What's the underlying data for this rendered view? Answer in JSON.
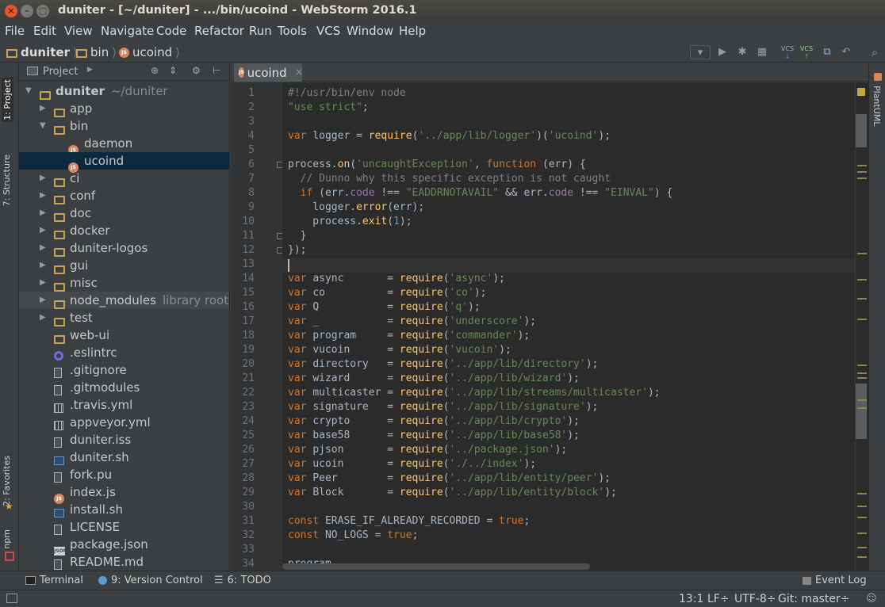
{
  "window": {
    "title": "duniter - [~/duniter] - .../bin/ucoind - WebStorm 2016.1",
    "close_glyph": "×",
    "min_glyph": "–",
    "max_glyph": "□"
  },
  "menu": [
    "File",
    "Edit",
    "View",
    "Navigate",
    "Code",
    "Refactor",
    "Run",
    "Tools",
    "VCS",
    "Window",
    "Help"
  ],
  "breadcrumb": [
    "duniter",
    "bin",
    "ucoind"
  ],
  "toolbar": {
    "vcs_label_1": "VCS",
    "vcs_label_2": "VCS"
  },
  "left_tabs": {
    "project": "1: Project",
    "structure": "7: Structure",
    "favorites": "2: Favorites",
    "npm": "npm"
  },
  "right_tabs": {
    "plantuml": "PlantUML"
  },
  "project_panel": {
    "header": "Project",
    "tree": [
      {
        "label": "duniter",
        "hint": "~/duniter",
        "icon": "folder-icon",
        "depth": 0,
        "arrow": "▼"
      },
      {
        "label": "app",
        "icon": "folder-icon",
        "depth": 1,
        "arrow": "▶"
      },
      {
        "label": "bin",
        "icon": "folder-icon",
        "depth": 1,
        "arrow": "▼"
      },
      {
        "label": "daemon",
        "icon": "js-icon",
        "depth": 2,
        "arrow": ""
      },
      {
        "label": "ucoind",
        "icon": "js-icon",
        "depth": 2,
        "arrow": "",
        "selected": true
      },
      {
        "label": "ci",
        "icon": "folder-icon",
        "depth": 1,
        "arrow": "▶"
      },
      {
        "label": "conf",
        "icon": "folder-icon",
        "depth": 1,
        "arrow": "▶"
      },
      {
        "label": "doc",
        "icon": "folder-icon",
        "depth": 1,
        "arrow": "▶"
      },
      {
        "label": "docker",
        "icon": "folder-icon",
        "depth": 1,
        "arrow": "▶"
      },
      {
        "label": "duniter-logos",
        "icon": "folder-icon",
        "depth": 1,
        "arrow": "▶"
      },
      {
        "label": "gui",
        "icon": "folder-icon",
        "depth": 1,
        "arrow": "▶"
      },
      {
        "label": "misc",
        "icon": "folder-icon",
        "depth": 1,
        "arrow": "▶"
      },
      {
        "label": "node_modules",
        "hint": "library root",
        "icon": "folder-icon",
        "depth": 1,
        "arrow": "▶",
        "library": true
      },
      {
        "label": "test",
        "icon": "folder-icon",
        "depth": 1,
        "arrow": "▶"
      },
      {
        "label": "web-ui",
        "icon": "folder-icon",
        "depth": 1,
        "arrow": ""
      },
      {
        "label": ".eslintrc",
        "icon": "eslint-icon",
        "depth": 1,
        "arrow": ""
      },
      {
        "label": ".gitignore",
        "icon": "text-file-icon",
        "depth": 1,
        "arrow": ""
      },
      {
        "label": ".gitmodules",
        "icon": "text-file-icon",
        "depth": 1,
        "arrow": ""
      },
      {
        "label": ".travis.yml",
        "icon": "yaml-file-icon",
        "depth": 1,
        "arrow": ""
      },
      {
        "label": "appveyor.yml",
        "icon": "yaml-file-icon",
        "depth": 1,
        "arrow": ""
      },
      {
        "label": "duniter.iss",
        "icon": "text-file-icon",
        "depth": 1,
        "arrow": ""
      },
      {
        "label": "duniter.sh",
        "icon": "shell-file-icon",
        "depth": 1,
        "arrow": ""
      },
      {
        "label": "fork.pu",
        "icon": "text-file-icon",
        "depth": 1,
        "arrow": ""
      },
      {
        "label": "index.js",
        "icon": "js-icon",
        "depth": 1,
        "arrow": ""
      },
      {
        "label": "install.sh",
        "icon": "shell-file-icon",
        "depth": 1,
        "arrow": ""
      },
      {
        "label": "LICENSE",
        "icon": "text-file-icon",
        "depth": 1,
        "arrow": ""
      },
      {
        "label": "package.json",
        "icon": "json-file-icon",
        "depth": 1,
        "arrow": ""
      },
      {
        "label": "README.md",
        "icon": "text-file-icon",
        "depth": 1,
        "arrow": ""
      }
    ]
  },
  "editor": {
    "tab_label": "ucoind",
    "lines": [
      [
        [
          "cmt",
          "#!/usr/bin/env node"
        ]
      ],
      [
        [
          "str",
          "\"use strict\""
        ],
        [
          "p",
          ";"
        ]
      ],
      [],
      [
        [
          "kw",
          "var "
        ],
        [
          "p",
          "logger = "
        ],
        [
          "fn",
          "require"
        ],
        [
          "p",
          "("
        ],
        [
          "str",
          "'../app/lib/logger'"
        ],
        [
          "p",
          ")("
        ],
        [
          "str",
          "'ucoind'"
        ],
        [
          "p",
          ");"
        ]
      ],
      [],
      [
        [
          "p",
          "process."
        ],
        [
          "fn",
          "on"
        ],
        [
          "p",
          "("
        ],
        [
          "str",
          "'uncaughtException'"
        ],
        [
          "p",
          ", "
        ],
        [
          "kw",
          "function "
        ],
        [
          "p",
          "(err) {"
        ]
      ],
      [
        [
          "cmt",
          "  // Dunno why this specific exception is not caught"
        ]
      ],
      [
        [
          "kw",
          "  if "
        ],
        [
          "p",
          "(err."
        ],
        [
          "prop",
          "code"
        ],
        [
          "p",
          " !== "
        ],
        [
          "str",
          "\"EADDRNOTAVAIL\""
        ],
        [
          "p",
          " && err."
        ],
        [
          "prop",
          "code"
        ],
        [
          "p",
          " !== "
        ],
        [
          "str",
          "\"EINVAL\""
        ],
        [
          "p",
          ") {"
        ]
      ],
      [
        [
          "p",
          "    logger."
        ],
        [
          "fn",
          "error"
        ],
        [
          "p",
          "(err);"
        ]
      ],
      [
        [
          "p",
          "    process."
        ],
        [
          "fn",
          "exit"
        ],
        [
          "p",
          "("
        ],
        [
          "num",
          "1"
        ],
        [
          "p",
          ");"
        ]
      ],
      [
        [
          "p",
          "  }"
        ]
      ],
      [
        [
          "p",
          "});"
        ]
      ],
      [],
      [
        [
          "kw",
          "var "
        ],
        [
          "p",
          "async       = "
        ],
        [
          "fn",
          "require"
        ],
        [
          "p",
          "("
        ],
        [
          "str",
          "'async'"
        ],
        [
          "p",
          ");"
        ]
      ],
      [
        [
          "kw",
          "var "
        ],
        [
          "p",
          "co          = "
        ],
        [
          "fn",
          "require"
        ],
        [
          "p",
          "("
        ],
        [
          "str",
          "'co'"
        ],
        [
          "p",
          ");"
        ]
      ],
      [
        [
          "kw",
          "var "
        ],
        [
          "p",
          "Q           = "
        ],
        [
          "fn",
          "require"
        ],
        [
          "p",
          "("
        ],
        [
          "str",
          "'q'"
        ],
        [
          "p",
          ");"
        ]
      ],
      [
        [
          "kw",
          "var "
        ],
        [
          "p",
          "_           = "
        ],
        [
          "fn",
          "require"
        ],
        [
          "p",
          "("
        ],
        [
          "str",
          "'underscore'"
        ],
        [
          "p",
          ");"
        ]
      ],
      [
        [
          "kw",
          "var "
        ],
        [
          "p",
          "program     = "
        ],
        [
          "fn",
          "require"
        ],
        [
          "p",
          "("
        ],
        [
          "str",
          "'commander'"
        ],
        [
          "p",
          ");"
        ]
      ],
      [
        [
          "kw",
          "var "
        ],
        [
          "p",
          "vucoin      = "
        ],
        [
          "fn",
          "require"
        ],
        [
          "p",
          "("
        ],
        [
          "str",
          "'vucoin'"
        ],
        [
          "p",
          ");"
        ]
      ],
      [
        [
          "kw",
          "var "
        ],
        [
          "p",
          "directory   = "
        ],
        [
          "fn",
          "require"
        ],
        [
          "p",
          "("
        ],
        [
          "str",
          "'../app/lib/directory'"
        ],
        [
          "p",
          ");"
        ]
      ],
      [
        [
          "kw",
          "var "
        ],
        [
          "p",
          "wizard      = "
        ],
        [
          "fn",
          "require"
        ],
        [
          "p",
          "("
        ],
        [
          "str",
          "'../app/lib/wizard'"
        ],
        [
          "p",
          ");"
        ]
      ],
      [
        [
          "kw",
          "var "
        ],
        [
          "p",
          "multicaster = "
        ],
        [
          "fn",
          "require"
        ],
        [
          "p",
          "("
        ],
        [
          "str",
          "'../app/lib/streams/multicaster'"
        ],
        [
          "p",
          ");"
        ]
      ],
      [
        [
          "kw",
          "var "
        ],
        [
          "p",
          "signature   = "
        ],
        [
          "fn",
          "require"
        ],
        [
          "p",
          "("
        ],
        [
          "str",
          "'../app/lib/signature'"
        ],
        [
          "p",
          ");"
        ]
      ],
      [
        [
          "kw",
          "var "
        ],
        [
          "p",
          "crypto      = "
        ],
        [
          "fn",
          "require"
        ],
        [
          "p",
          "("
        ],
        [
          "str",
          "'../app/lib/crypto'"
        ],
        [
          "p",
          ");"
        ]
      ],
      [
        [
          "kw",
          "var "
        ],
        [
          "p",
          "base58      = "
        ],
        [
          "fn",
          "require"
        ],
        [
          "p",
          "("
        ],
        [
          "str",
          "'../app/lib/base58'"
        ],
        [
          "p",
          ");"
        ]
      ],
      [
        [
          "kw",
          "var "
        ],
        [
          "p",
          "pjson       = "
        ],
        [
          "fn",
          "require"
        ],
        [
          "p",
          "("
        ],
        [
          "str",
          "'../package.json'"
        ],
        [
          "p",
          ");"
        ]
      ],
      [
        [
          "kw",
          "var "
        ],
        [
          "p",
          "ucoin       = "
        ],
        [
          "fn",
          "require"
        ],
        [
          "p",
          "("
        ],
        [
          "str",
          "'./../index'"
        ],
        [
          "p",
          ");"
        ]
      ],
      [
        [
          "kw",
          "var "
        ],
        [
          "p",
          "Peer        = "
        ],
        [
          "fn",
          "require"
        ],
        [
          "p",
          "("
        ],
        [
          "str",
          "'../app/lib/entity/peer'"
        ],
        [
          "p",
          ");"
        ]
      ],
      [
        [
          "kw",
          "var "
        ],
        [
          "p",
          "Block       = "
        ],
        [
          "fn",
          "require"
        ],
        [
          "p",
          "("
        ],
        [
          "str",
          "'../app/lib/entity/block'"
        ],
        [
          "p",
          ");"
        ]
      ],
      [],
      [
        [
          "kw",
          "const "
        ],
        [
          "p",
          "ERASE_IF_ALREADY_RECORDED = "
        ],
        [
          "kw",
          "true"
        ],
        [
          "p",
          ";"
        ]
      ],
      [
        [
          "kw",
          "const "
        ],
        [
          "p",
          "NO_LOGS = "
        ],
        [
          "kw",
          "true"
        ],
        [
          "p",
          ";"
        ]
      ],
      [],
      [
        [
          "p",
          "program"
        ]
      ]
    ]
  },
  "bottom_tabs": {
    "terminal": "Terminal",
    "version_control": "9: Version Control",
    "todo": "6: TODO",
    "event_log": "Event Log"
  },
  "status": {
    "position": "13:1",
    "line_sep": "LF÷",
    "encoding": "UTF-8÷",
    "git": "Git: master÷"
  },
  "colors": {
    "keyword": "#cc7832",
    "string": "#6a8759",
    "number": "#6897bb",
    "comment": "#808080",
    "selection": "#0d293e"
  }
}
